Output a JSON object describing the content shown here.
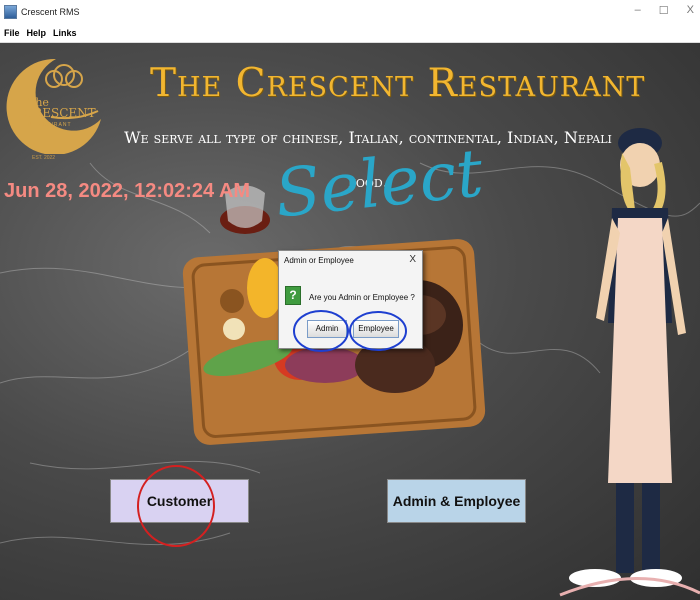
{
  "window": {
    "title": "Crescent RMS",
    "controls": {
      "minimize": "–",
      "maximize": "☐",
      "close": "X"
    }
  },
  "menu": [
    "File",
    "Help",
    "Links"
  ],
  "logo": {
    "line1": "The",
    "line2": "CRESCENT",
    "line3": "RESTAURANT",
    "est": "EST. 2022"
  },
  "header": {
    "title": "The Crescent Restaurant",
    "tagline": "We serve all type of chinese, Italian, continental, Indian, Nepali food."
  },
  "datetime": "Jun 28, 2022, 12:02:24 AM",
  "annotation": {
    "select": "Select"
  },
  "dialog": {
    "title": "Admin or Employee",
    "close": "X",
    "icon": "?",
    "message": "Are you Admin or Employee ?",
    "buttons": [
      "Admin",
      "Employee"
    ]
  },
  "buttons": {
    "customer": "Customer",
    "admin_employee": "Admin & Employee"
  },
  "colors": {
    "headline": "#f2b630",
    "clock": "#f58a82",
    "select": "#2aa6c8",
    "circle_blue": "#1e3fd0",
    "circle_red": "#d42020"
  }
}
